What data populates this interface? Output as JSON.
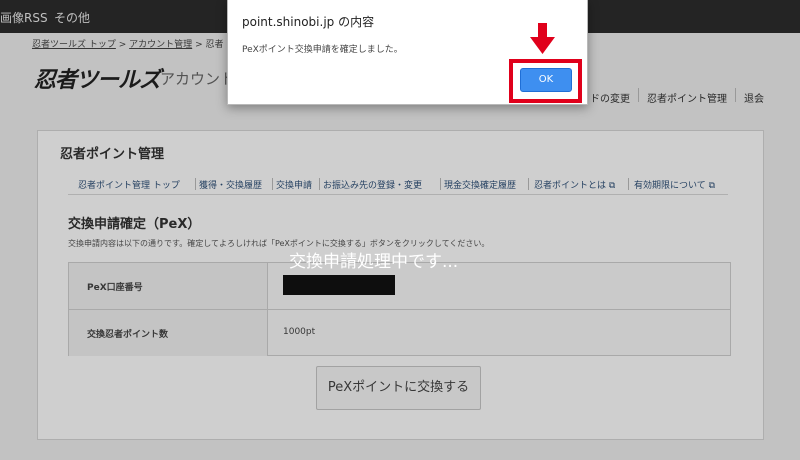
{
  "topbar": {
    "item1": "画像RSS",
    "item2": "その他"
  },
  "breadcrumb": {
    "home": "忍者ツールズ トップ",
    "sep": ">",
    "account": "アカウント管理",
    "current": "忍者"
  },
  "header": {
    "logo": "忍者ツールズ",
    "subtitle": "アカウント",
    "nav": [
      "ドの変更",
      "忍者ポイント管理",
      "退会"
    ]
  },
  "card": {
    "title": "忍者ポイント管理",
    "subnav": [
      "忍者ポイント管理 トップ",
      "獲得・交換履歴",
      "交換申請",
      "お振込み先の登録・変更",
      "現金交換確定履歴",
      "忍者ポイントとは",
      "有効期限について"
    ]
  },
  "section": {
    "title": "交換申請確定（PeX）",
    "description": "交換申請内容は以下の通りです。確定してよろしければ「PeXポイントに交換する」ボタンをクリックしてください。"
  },
  "table": {
    "rows": [
      {
        "label": "PeX口座番号",
        "value": ""
      },
      {
        "label": "交換忍者ポイント数",
        "value": "1000pt"
      }
    ]
  },
  "processing_text": "交換申請処理中です...",
  "submit_label": "PeXポイントに交換する",
  "dialog": {
    "title": "point.shinobi.jp の内容",
    "message": "PeXポイント交換申請を確定しました。",
    "ok_label": "OK"
  },
  "colors": {
    "highlight": "#e0001b",
    "ok_button": "#3e8ff0",
    "topbar": "#1c1c1c"
  },
  "icons": {
    "annotation_arrow": "arrow-down-icon",
    "external_link": "external-link-icon"
  }
}
